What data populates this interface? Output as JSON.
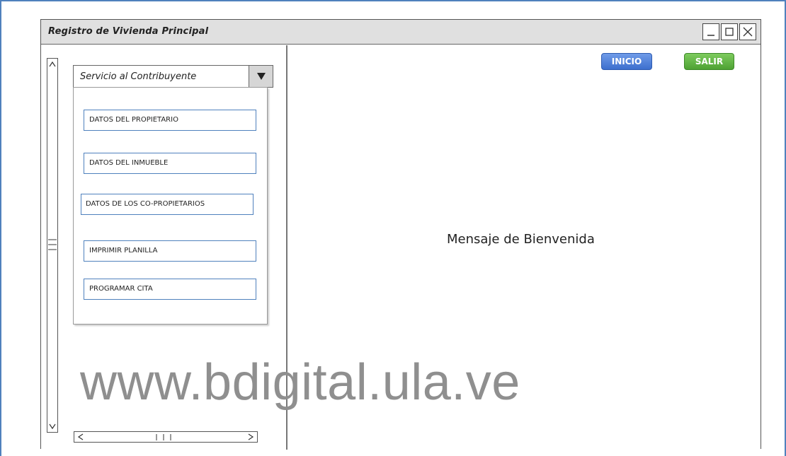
{
  "window": {
    "title": "Registro de Vivienda Principal",
    "controls": [
      "minimize-icon",
      "maximize-icon",
      "close-icon"
    ]
  },
  "sidebar": {
    "dropdown": {
      "selected": "Servicio al Contribuyente",
      "icon": "triangle-down-icon"
    },
    "menu_items": [
      {
        "label": "DATOS DEL PROPIETARIO"
      },
      {
        "label": "DATOS DEL INMUEBLE"
      },
      {
        "label": "DATOS DE LOS CO-PROPIETARIOS"
      },
      {
        "label": "IMPRIMIR PLANILLA"
      },
      {
        "label": "PROGRAMAR CITA"
      }
    ]
  },
  "toolbar": {
    "inicio_label": "INICIO",
    "salir_label": "SALIR",
    "inicio_color": "#4a7bd8",
    "salir_color": "#5cb13f"
  },
  "main": {
    "welcome_text": "Mensaje de Bienvenida"
  },
  "watermark": {
    "text": "www.bdigital.ula.ve"
  }
}
